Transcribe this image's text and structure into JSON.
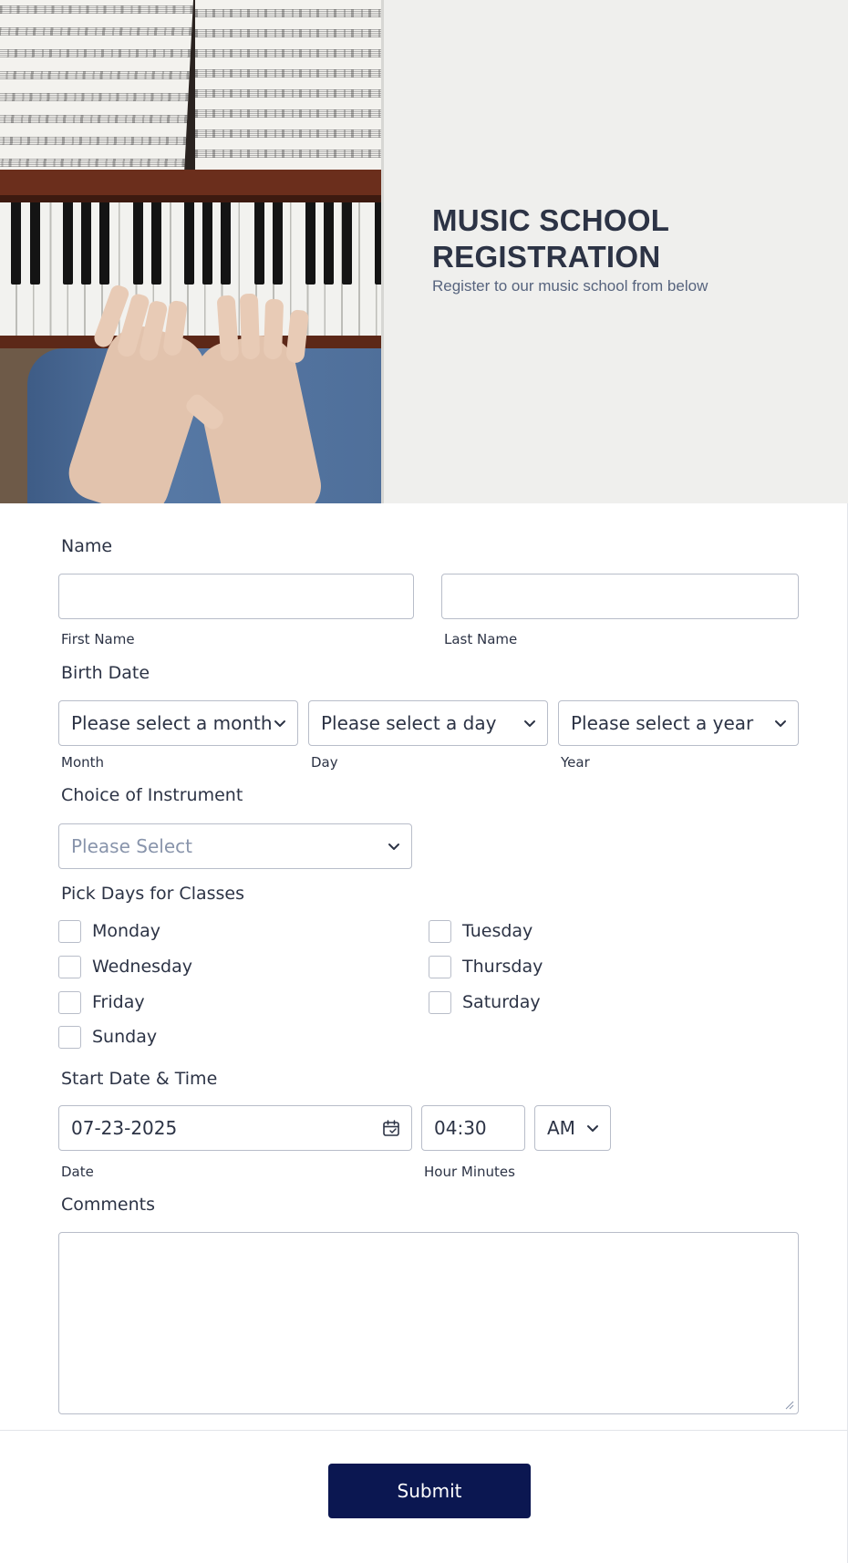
{
  "header": {
    "title_line1": "MUSIC SCHOOL",
    "title_line2": "REGISTRATION",
    "subtitle": "Register to our music school from below",
    "image": "piano-hands-photo"
  },
  "name": {
    "label": "Name",
    "first_value": "",
    "last_value": "",
    "first_sublabel": "First Name",
    "last_sublabel": "Last Name"
  },
  "birth_date": {
    "label": "Birth Date",
    "month_value": "Please select a month",
    "day_value": "Please select a day",
    "year_value": "Please select a year",
    "month_sublabel": "Month",
    "day_sublabel": "Day",
    "year_sublabel": "Year"
  },
  "instrument": {
    "label": "Choice of Instrument",
    "placeholder": "Please Select"
  },
  "days": {
    "label": "Pick Days for Classes",
    "options": [
      "Monday",
      "Tuesday",
      "Wednesday",
      "Thursday",
      "Friday",
      "Saturday",
      "Sunday"
    ],
    "checked": [
      false,
      false,
      false,
      false,
      false,
      false,
      false
    ]
  },
  "start": {
    "label": "Start Date & Time",
    "date_value": "07-23-2025",
    "time_value": "04:30",
    "ampm_value": "AM",
    "date_sublabel": "Date",
    "time_sublabel": "Hour Minutes"
  },
  "comments": {
    "label": "Comments",
    "value": ""
  },
  "submit": {
    "label": "Submit",
    "color": "#0b1751"
  },
  "icons": {
    "chevron": "chevron-down-icon",
    "calendar": "calendar-icon"
  }
}
